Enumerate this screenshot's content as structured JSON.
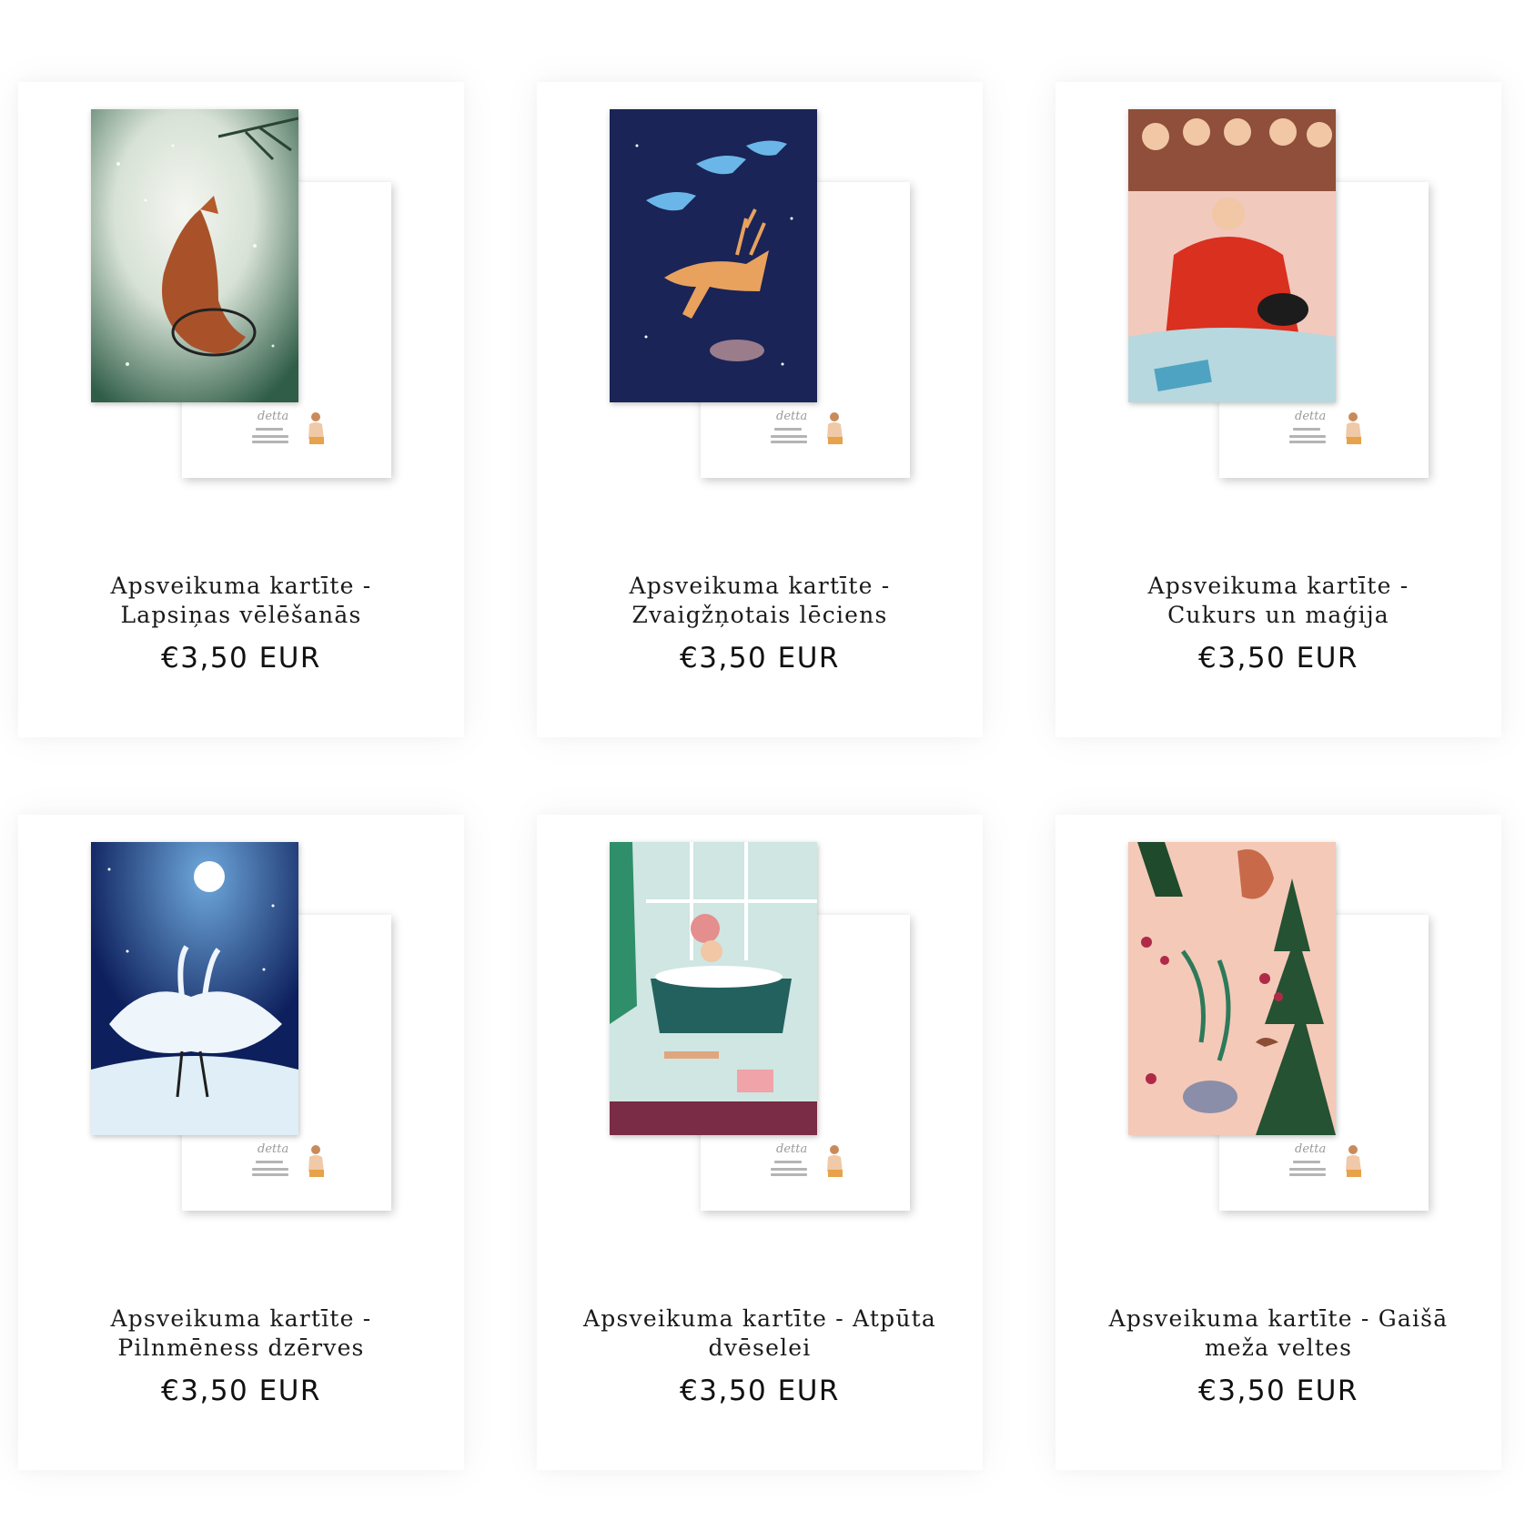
{
  "products": [
    {
      "title": "Apsveikuma kartīte - Lapsiņas vēlēšanās",
      "price": "€3,50 EUR",
      "image_subject": "fox-in-snow"
    },
    {
      "title": "Apsveikuma kartīte - Zvaigžņotais lēciens",
      "price": "€3,50 EUR",
      "image_subject": "leaping-deer"
    },
    {
      "title": "Apsveikuma kartīte - Cukurs un maģija",
      "price": "€3,50 EUR",
      "image_subject": "girl-with-dog"
    },
    {
      "title": "Apsveikuma kartīte - Pilnmēness dzērves",
      "price": "€3,50 EUR",
      "image_subject": "cranes-under-moon"
    },
    {
      "title": "Apsveikuma kartīte - Atpūta dvēselei",
      "price": "€3,50 EUR",
      "image_subject": "woman-in-bath"
    },
    {
      "title": "Apsveikuma kartīte - Gaišā meža veltes",
      "price": "€3,50 EUR",
      "image_subject": "forest-gifts"
    }
  ]
}
